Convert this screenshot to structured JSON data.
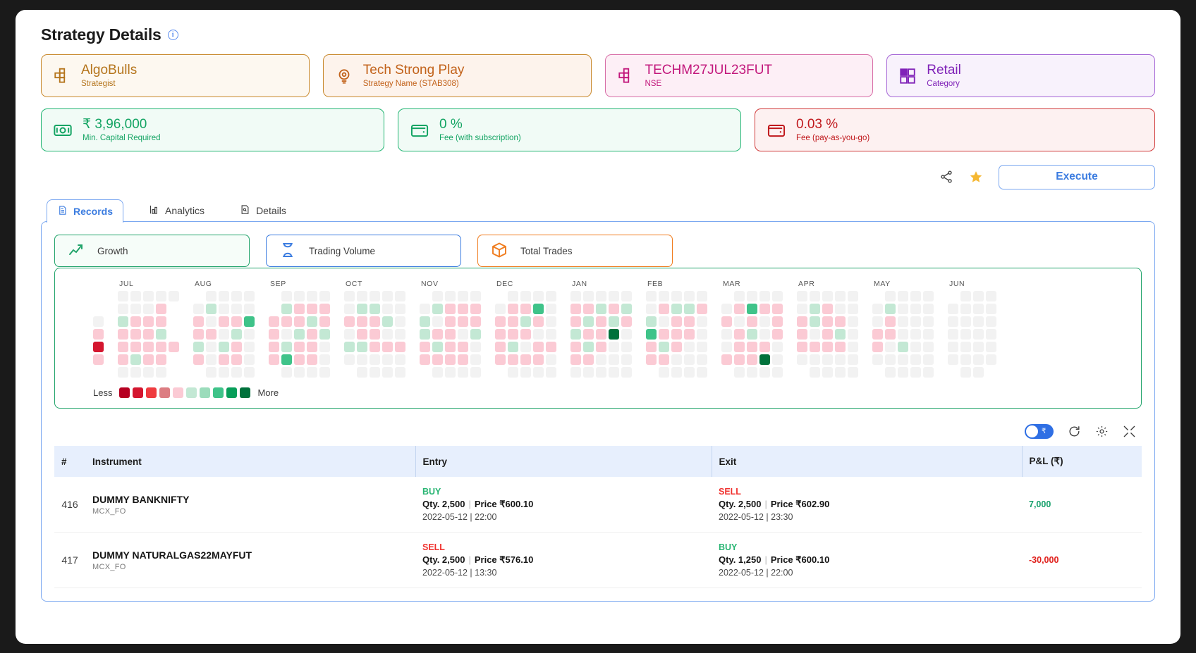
{
  "header": {
    "title": "Strategy Details",
    "info_icon": "info-icon"
  },
  "cards_row1": [
    {
      "icon": "grid-blocks-icon",
      "value": "AlgoBulls",
      "label": "Strategist",
      "theme": "amber"
    },
    {
      "icon": "lightbulb-icon",
      "value": "Tech Strong Play",
      "label": "Strategy Name (STAB308)",
      "theme": "peach"
    },
    {
      "icon": "grid-blocks-icon",
      "value": "TECHM27JUL23FUT",
      "label": "NSE",
      "theme": "pink"
    },
    {
      "icon": "squares-icon",
      "value": "Retail",
      "label": "Category",
      "theme": "violet"
    }
  ],
  "cards_row2": [
    {
      "icon": "banknote-icon",
      "value": "₹ 3,96,000",
      "label": "Min. Capital Required",
      "theme": "green"
    },
    {
      "icon": "wallet-icon",
      "value": "0 %",
      "label": "Fee (with subscription)",
      "theme": "green"
    },
    {
      "icon": "wallet-icon",
      "value": "0.03 %",
      "label": "Fee (pay-as-you-go)",
      "theme": "red"
    }
  ],
  "actions": {
    "share_icon": "share-icon",
    "favorite_icon": "star-icon",
    "execute_label": "Execute"
  },
  "tabs": [
    {
      "label": "Records",
      "icon": "records-icon",
      "active": true
    },
    {
      "label": "Analytics",
      "icon": "bar-chart-icon",
      "active": false
    },
    {
      "label": "Details",
      "icon": "document-icon",
      "active": false
    }
  ],
  "subtabs": [
    {
      "label": "Growth",
      "icon": "trend-up-icon",
      "theme": "green",
      "active": true
    },
    {
      "label": "Trading Volume",
      "icon": "hourglass-icon",
      "theme": "blue",
      "active": false
    },
    {
      "label": "Total Trades",
      "icon": "box-icon",
      "theme": "orange",
      "active": false
    }
  ],
  "chart_data": {
    "type": "heatmap",
    "title": "Growth",
    "months": [
      "JUL",
      "AUG",
      "SEP",
      "OCT",
      "NOV",
      "DEC",
      "JAN",
      "FEB",
      "MAR",
      "APR",
      "MAY",
      "JUN"
    ],
    "legend": {
      "less_label": "Less",
      "more_label": "More",
      "colors": [
        "#b60021",
        "#d4162f",
        "#ef3b3f",
        "#dc7d82",
        "#fbcad4",
        "#c3e8d4",
        "#9bdcbb",
        "#3fc389",
        "#079e59",
        "#00713b"
      ]
    },
    "empty_color": "#f2f2f2",
    "cell_rows": 7,
    "columns": [
      {
        "month": "",
        "cells": [
          null,
          null,
          "#f2f2f2",
          "#fbcad4",
          "#d4162f",
          "#fbcad4",
          null
        ]
      },
      {
        "month": "JUL",
        "cells": [
          "#f2f2f2",
          "#f2f2f2",
          "#c3e8d4",
          "#fbcad4",
          "#fbcad4",
          "#fbcad4",
          "#f2f2f2"
        ]
      },
      {
        "month": "JUL",
        "cells": [
          "#f2f2f2",
          "#f2f2f2",
          "#fbcad4",
          "#fbcad4",
          "#fbcad4",
          "#c3e8d4",
          "#f2f2f2"
        ]
      },
      {
        "month": "JUL",
        "cells": [
          "#f2f2f2",
          "#f2f2f2",
          "#fbcad4",
          "#fbcad4",
          "#fbcad4",
          "#fbcad4",
          "#f2f2f2"
        ]
      },
      {
        "month": "JUL",
        "cells": [
          "#f2f2f2",
          "#fbcad4",
          "#fbcad4",
          "#c3e8d4",
          "#fbcad4",
          "#fbcad4",
          "#f2f2f2"
        ]
      },
      {
        "month": "JUL",
        "cells": [
          "#f2f2f2",
          null,
          null,
          null,
          "#fbcad4",
          null,
          null
        ]
      },
      {
        "month": "AUG",
        "cells": [
          null,
          "#f2f2f2",
          "#fbcad4",
          "#fbcad4",
          "#c3e8d4",
          "#fbcad4",
          null
        ]
      },
      {
        "month": "AUG",
        "cells": [
          "#f2f2f2",
          "#c3e8d4",
          "#f2f2f2",
          "#fbcad4",
          "#f2f2f2",
          "#f2f2f2",
          "#f2f2f2"
        ]
      },
      {
        "month": "AUG",
        "cells": [
          "#f2f2f2",
          "#f2f2f2",
          "#fbcad4",
          "#f2f2f2",
          "#c3e8d4",
          "#fbcad4",
          "#f2f2f2"
        ]
      },
      {
        "month": "AUG",
        "cells": [
          "#f2f2f2",
          "#f2f2f2",
          "#fbcad4",
          "#c3e8d4",
          "#fbcad4",
          "#fbcad4",
          "#f2f2f2"
        ]
      },
      {
        "month": "AUG",
        "cells": [
          "#f2f2f2",
          "#f2f2f2",
          "#3fc389",
          "#f2f2f2",
          "#f2f2f2",
          "#f2f2f2",
          "#f2f2f2"
        ]
      },
      {
        "month": "SEP",
        "cells": [
          null,
          null,
          "#fbcad4",
          "#fbcad4",
          "#fbcad4",
          "#fbcad4",
          null
        ]
      },
      {
        "month": "SEP",
        "cells": [
          "#f2f2f2",
          "#c3e8d4",
          "#fbcad4",
          "#f2f2f2",
          "#c3e8d4",
          "#3fc389",
          "#f2f2f2"
        ]
      },
      {
        "month": "SEP",
        "cells": [
          "#f2f2f2",
          "#fbcad4",
          "#fbcad4",
          "#c3e8d4",
          "#fbcad4",
          "#fbcad4",
          "#f2f2f2"
        ]
      },
      {
        "month": "SEP",
        "cells": [
          "#f2f2f2",
          "#fbcad4",
          "#c3e8d4",
          "#fbcad4",
          "#fbcad4",
          "#fbcad4",
          "#f2f2f2"
        ]
      },
      {
        "month": "SEP",
        "cells": [
          "#f2f2f2",
          "#fbcad4",
          "#fbcad4",
          "#c3e8d4",
          "#f2f2f2",
          "#f2f2f2",
          "#f2f2f2"
        ]
      },
      {
        "month": "OCT",
        "cells": [
          "#f2f2f2",
          "#f2f2f2",
          "#fbcad4",
          "#f2f2f2",
          "#c3e8d4",
          "#f2f2f2",
          null
        ]
      },
      {
        "month": "OCT",
        "cells": [
          "#f2f2f2",
          "#c3e8d4",
          "#fbcad4",
          "#fbcad4",
          "#c3e8d4",
          "#f2f2f2",
          "#f2f2f2"
        ]
      },
      {
        "month": "OCT",
        "cells": [
          "#f2f2f2",
          "#c3e8d4",
          "#fbcad4",
          "#fbcad4",
          "#fbcad4",
          "#f2f2f2",
          "#f2f2f2"
        ]
      },
      {
        "month": "OCT",
        "cells": [
          "#f2f2f2",
          "#f2f2f2",
          "#c3e8d4",
          "#f2f2f2",
          "#fbcad4",
          "#f2f2f2",
          "#f2f2f2"
        ]
      },
      {
        "month": "OCT",
        "cells": [
          "#f2f2f2",
          "#f2f2f2",
          "#f2f2f2",
          "#f2f2f2",
          "#fbcad4",
          "#f2f2f2",
          "#f2f2f2"
        ]
      },
      {
        "month": "NOV",
        "cells": [
          null,
          "#f2f2f2",
          "#c3e8d4",
          "#c3e8d4",
          "#fbcad4",
          "#fbcad4",
          null
        ]
      },
      {
        "month": "NOV",
        "cells": [
          "#f2f2f2",
          "#c3e8d4",
          "#f2f2f2",
          "#fbcad4",
          "#c3e8d4",
          "#fbcad4",
          "#f2f2f2"
        ]
      },
      {
        "month": "NOV",
        "cells": [
          "#f2f2f2",
          "#fbcad4",
          "#fbcad4",
          "#fbcad4",
          "#fbcad4",
          "#fbcad4",
          "#f2f2f2"
        ]
      },
      {
        "month": "NOV",
        "cells": [
          "#f2f2f2",
          "#fbcad4",
          "#fbcad4",
          "#f2f2f2",
          "#fbcad4",
          "#fbcad4",
          "#f2f2f2"
        ]
      },
      {
        "month": "NOV",
        "cells": [
          "#f2f2f2",
          "#fbcad4",
          "#fbcad4",
          "#c3e8d4",
          "#f2f2f2",
          "#f2f2f2",
          "#f2f2f2"
        ]
      },
      {
        "month": "DEC",
        "cells": [
          null,
          "#f2f2f2",
          "#fbcad4",
          "#fbcad4",
          "#fbcad4",
          "#fbcad4",
          null
        ]
      },
      {
        "month": "DEC",
        "cells": [
          "#f2f2f2",
          "#fbcad4",
          "#fbcad4",
          "#fbcad4",
          "#c3e8d4",
          "#fbcad4",
          "#f2f2f2"
        ]
      },
      {
        "month": "DEC",
        "cells": [
          "#f2f2f2",
          "#fbcad4",
          "#c3e8d4",
          "#fbcad4",
          "#f2f2f2",
          "#fbcad4",
          "#f2f2f2"
        ]
      },
      {
        "month": "DEC",
        "cells": [
          "#f2f2f2",
          "#3fc389",
          "#fbcad4",
          "#f2f2f2",
          "#fbcad4",
          "#fbcad4",
          "#f2f2f2"
        ]
      },
      {
        "month": "DEC",
        "cells": [
          "#f2f2f2",
          "#f2f2f2",
          "#f2f2f2",
          "#f2f2f2",
          "#fbcad4",
          "#f2f2f2",
          "#f2f2f2"
        ]
      },
      {
        "month": "JAN",
        "cells": [
          "#f2f2f2",
          "#fbcad4",
          "#fbcad4",
          "#c3e8d4",
          "#fbcad4",
          "#fbcad4",
          "#f2f2f2"
        ]
      },
      {
        "month": "JAN",
        "cells": [
          "#f2f2f2",
          "#fbcad4",
          "#c3e8d4",
          "#fbcad4",
          "#c3e8d4",
          "#fbcad4",
          "#f2f2f2"
        ]
      },
      {
        "month": "JAN",
        "cells": [
          "#f2f2f2",
          "#c3e8d4",
          "#fbcad4",
          "#fbcad4",
          "#fbcad4",
          "#f2f2f2",
          "#f2f2f2"
        ]
      },
      {
        "month": "JAN",
        "cells": [
          "#f2f2f2",
          "#fbcad4",
          "#c3e8d4",
          "#00713b",
          "#f2f2f2",
          "#f2f2f2",
          "#f2f2f2"
        ]
      },
      {
        "month": "JAN",
        "cells": [
          "#f2f2f2",
          "#c3e8d4",
          "#fbcad4",
          "#f2f2f2",
          "#f2f2f2",
          "#f2f2f2",
          "#f2f2f2"
        ]
      },
      {
        "month": "FEB",
        "cells": [
          "#f2f2f2",
          "#f2f2f2",
          "#c3e8d4",
          "#3fc389",
          "#fbcad4",
          "#fbcad4",
          null
        ]
      },
      {
        "month": "FEB",
        "cells": [
          "#f2f2f2",
          "#fbcad4",
          "#f2f2f2",
          "#fbcad4",
          "#c3e8d4",
          "#fbcad4",
          "#f2f2f2"
        ]
      },
      {
        "month": "FEB",
        "cells": [
          "#f2f2f2",
          "#c3e8d4",
          "#fbcad4",
          "#fbcad4",
          "#fbcad4",
          "#f2f2f2",
          "#f2f2f2"
        ]
      },
      {
        "month": "FEB",
        "cells": [
          "#f2f2f2",
          "#c3e8d4",
          "#fbcad4",
          "#fbcad4",
          "#f2f2f2",
          "#f2f2f2",
          "#f2f2f2"
        ]
      },
      {
        "month": "FEB",
        "cells": [
          "#f2f2f2",
          "#fbcad4",
          "#f2f2f2",
          "#f2f2f2",
          "#f2f2f2",
          "#f2f2f2",
          "#f2f2f2"
        ]
      },
      {
        "month": "MAR",
        "cells": [
          null,
          "#f2f2f2",
          "#fbcad4",
          "#f2f2f2",
          "#f2f2f2",
          "#fbcad4",
          null
        ]
      },
      {
        "month": "MAR",
        "cells": [
          "#f2f2f2",
          "#fbcad4",
          "#f2f2f2",
          "#fbcad4",
          "#fbcad4",
          "#fbcad4",
          "#f2f2f2"
        ]
      },
      {
        "month": "MAR",
        "cells": [
          "#f2f2f2",
          "#3fc389",
          "#fbcad4",
          "#c3e8d4",
          "#fbcad4",
          "#fbcad4",
          "#f2f2f2"
        ]
      },
      {
        "month": "MAR",
        "cells": [
          "#f2f2f2",
          "#fbcad4",
          "#f2f2f2",
          "#f2f2f2",
          "#fbcad4",
          "#00713b",
          "#f2f2f2"
        ]
      },
      {
        "month": "MAR",
        "cells": [
          "#f2f2f2",
          "#fbcad4",
          "#fbcad4",
          "#fbcad4",
          "#f2f2f2",
          "#f2f2f2",
          "#f2f2f2"
        ]
      },
      {
        "month": "APR",
        "cells": [
          "#f2f2f2",
          "#f2f2f2",
          "#fbcad4",
          "#fbcad4",
          "#fbcad4",
          "#f2f2f2",
          null
        ]
      },
      {
        "month": "APR",
        "cells": [
          "#f2f2f2",
          "#c3e8d4",
          "#c3e8d4",
          "#f2f2f2",
          "#fbcad4",
          "#f2f2f2",
          "#f2f2f2"
        ]
      },
      {
        "month": "APR",
        "cells": [
          "#f2f2f2",
          "#fbcad4",
          "#fbcad4",
          "#fbcad4",
          "#fbcad4",
          "#f2f2f2",
          "#f2f2f2"
        ]
      },
      {
        "month": "APR",
        "cells": [
          "#f2f2f2",
          "#f2f2f2",
          "#fbcad4",
          "#c3e8d4",
          "#fbcad4",
          "#f2f2f2",
          "#f2f2f2"
        ]
      },
      {
        "month": "APR",
        "cells": [
          "#f2f2f2",
          "#f2f2f2",
          "#f2f2f2",
          "#f2f2f2",
          "#f2f2f2",
          "#f2f2f2",
          "#f2f2f2"
        ]
      },
      {
        "month": "MAY",
        "cells": [
          null,
          "#f2f2f2",
          "#f2f2f2",
          "#fbcad4",
          "#fbcad4",
          "#f2f2f2",
          null
        ]
      },
      {
        "month": "MAY",
        "cells": [
          "#f2f2f2",
          "#c3e8d4",
          "#fbcad4",
          "#fbcad4",
          "#f2f2f2",
          "#f2f2f2",
          "#f2f2f2"
        ]
      },
      {
        "month": "MAY",
        "cells": [
          "#f2f2f2",
          "#f2f2f2",
          "#f2f2f2",
          "#f2f2f2",
          "#c3e8d4",
          "#f2f2f2",
          "#f2f2f2"
        ]
      },
      {
        "month": "MAY",
        "cells": [
          "#f2f2f2",
          "#f2f2f2",
          "#f2f2f2",
          "#f2f2f2",
          "#f2f2f2",
          "#f2f2f2",
          "#f2f2f2"
        ]
      },
      {
        "month": "MAY",
        "cells": [
          "#f2f2f2",
          "#f2f2f2",
          "#f2f2f2",
          "#f2f2f2",
          "#f2f2f2",
          "#f2f2f2",
          "#f2f2f2"
        ]
      },
      {
        "month": "JUN",
        "cells": [
          null,
          "#f2f2f2",
          "#f2f2f2",
          "#f2f2f2",
          "#f2f2f2",
          "#f2f2f2",
          null
        ]
      },
      {
        "month": "JUN",
        "cells": [
          "#f2f2f2",
          "#f2f2f2",
          "#f2f2f2",
          "#f2f2f2",
          "#f2f2f2",
          "#f2f2f2",
          "#f2f2f2"
        ]
      },
      {
        "month": "JUN",
        "cells": [
          "#f2f2f2",
          "#f2f2f2",
          "#f2f2f2",
          "#f2f2f2",
          "#f2f2f2",
          "#f2f2f2",
          "#f2f2f2"
        ]
      },
      {
        "month": "JUN",
        "cells": [
          "#f2f2f2",
          "#f2f2f2",
          "#f2f2f2",
          "#f2f2f2",
          "#f2f2f2",
          "#f2f2f2",
          null
        ]
      }
    ]
  },
  "table_toolbar": {
    "currency_toggle": {
      "icon": "rupee-toggle",
      "symbol": "₹",
      "on": true
    },
    "refresh_icon": "refresh-icon",
    "settings_icon": "gear-icon",
    "expand_icon": "expand-icon"
  },
  "table": {
    "columns": [
      "#",
      "Instrument",
      "Entry",
      "Exit",
      "P&L (₹)"
    ],
    "rows": [
      {
        "index": "416",
        "instrument": "DUMMY BANKNIFTY",
        "segment": "MCX_FO",
        "entry": {
          "side": "BUY",
          "qty": "Qty. 2,500",
          "price": "Price ₹600.10",
          "time": "2022-05-12 | 22:00"
        },
        "exit": {
          "side": "SELL",
          "qty": "Qty. 2,500",
          "price": "Price ₹602.90",
          "time": "2022-05-12 | 23:30"
        },
        "pl": "7,000",
        "pl_sign": "pos"
      },
      {
        "index": "417",
        "instrument": "DUMMY NATURALGAS22MAYFUT",
        "segment": "MCX_FO",
        "entry": {
          "side": "SELL",
          "qty": "Qty. 2,500",
          "price": "Price ₹576.10",
          "time": "2022-05-12 | 13:30"
        },
        "exit": {
          "side": "BUY",
          "qty": "Qty. 1,250",
          "price": "Price ₹600.10",
          "time": "2022-05-12 | 22:00"
        },
        "pl": "-30,000",
        "pl_sign": "neg"
      }
    ]
  }
}
